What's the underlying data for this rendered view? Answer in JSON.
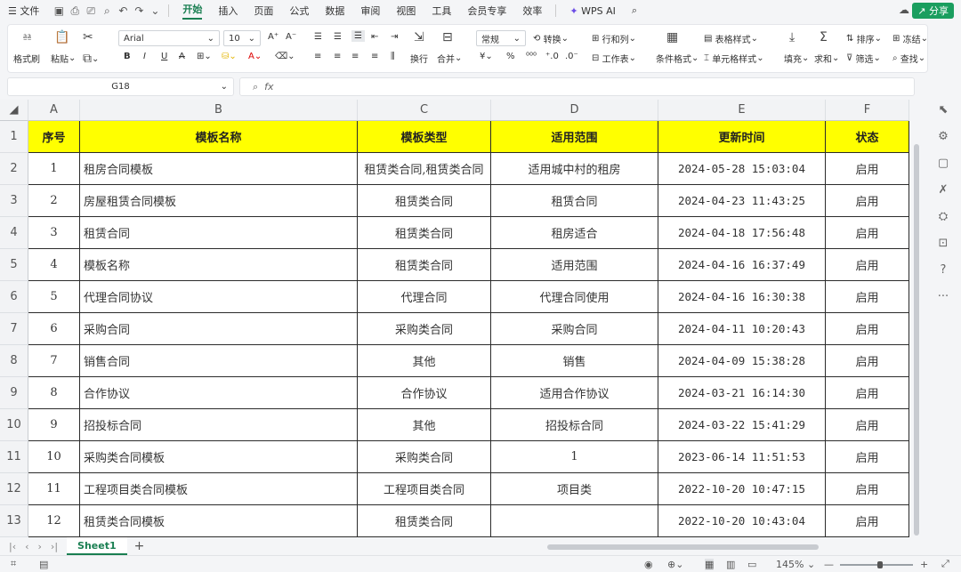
{
  "menubar": {
    "file": "文件",
    "tabs": [
      "开始",
      "插入",
      "页面",
      "公式",
      "数据",
      "审阅",
      "视图",
      "工具",
      "会员专享",
      "效率"
    ],
    "active_tab": "开始",
    "wps_ai": "WPS AI",
    "share": "分享"
  },
  "ribbon": {
    "format_painter": "格式刷",
    "paste": "粘贴",
    "font_name": "Arial",
    "font_size": "10",
    "wrap": "换行",
    "merge": "合并",
    "number_format": "常规",
    "convert": "转换",
    "row_col": "行和列",
    "worksheet": "工作表",
    "conditional": "条件格式",
    "table_style": "表格样式",
    "cell_style": "单元格样式",
    "fill": "填充",
    "sum": "求和",
    "sort": "排序",
    "filter": "筛选",
    "freeze": "冻结",
    "find": "查找",
    "currency": "¥",
    "percent": "%"
  },
  "formula_bar": {
    "cell_ref": "G18",
    "fx": "fx",
    "value": ""
  },
  "columns": [
    "A",
    "B",
    "C",
    "D",
    "E",
    "F"
  ],
  "rows": [
    "1",
    "2",
    "3",
    "4",
    "5",
    "6",
    "7",
    "8",
    "9",
    "10",
    "11",
    "12",
    "13"
  ],
  "table": {
    "headers": [
      "序号",
      "模板名称",
      "模板类型",
      "适用范围",
      "更新时间",
      "状态"
    ],
    "data": [
      [
        "1",
        "租房合同模板",
        "租赁类合同,租赁类合同",
        "适用城中村的租房",
        "2024-05-28 15:03:04",
        "启用"
      ],
      [
        "2",
        "房屋租赁合同模板",
        "租赁类合同",
        "租赁合同",
        "2024-04-23 11:43:25",
        "启用"
      ],
      [
        "3",
        "租赁合同",
        "租赁类合同",
        "租房适合",
        "2024-04-18 17:56:48",
        "启用"
      ],
      [
        "4",
        "模板名称",
        "租赁类合同",
        "适用范围",
        "2024-04-16 16:37:49",
        "启用"
      ],
      [
        "5",
        "代理合同协议",
        "代理合同",
        "代理合同使用",
        "2024-04-16 16:30:38",
        "启用"
      ],
      [
        "6",
        "采购合同",
        "采购类合同",
        "采购合同",
        "2024-04-11 10:20:43",
        "启用"
      ],
      [
        "7",
        "销售合同",
        "其他",
        "销售",
        "2024-04-09 15:38:28",
        "启用"
      ],
      [
        "8",
        "合作协议",
        "合作协议",
        "适用合作协议",
        "2024-03-21 16:14:30",
        "启用"
      ],
      [
        "9",
        "招投标合同",
        "其他",
        "招投标合同",
        "2024-03-22 15:41:29",
        "启用"
      ],
      [
        "10",
        "采购类合同模板",
        "采购类合同",
        "1",
        "2023-06-14 11:51:53",
        "启用"
      ],
      [
        "11",
        "工程项目类合同模板",
        "工程项目类合同",
        "项目类",
        "2022-10-20 10:47:15",
        "启用"
      ],
      [
        "12",
        "租赁类合同模板",
        "租赁类合同",
        "",
        "2022-10-20 10:43:04",
        "启用"
      ]
    ]
  },
  "sheet_tab": "Sheet1",
  "status": {
    "zoom": "145%"
  },
  "colors": {
    "accent": "#1a7f52",
    "header_fill": "#ffff00"
  }
}
